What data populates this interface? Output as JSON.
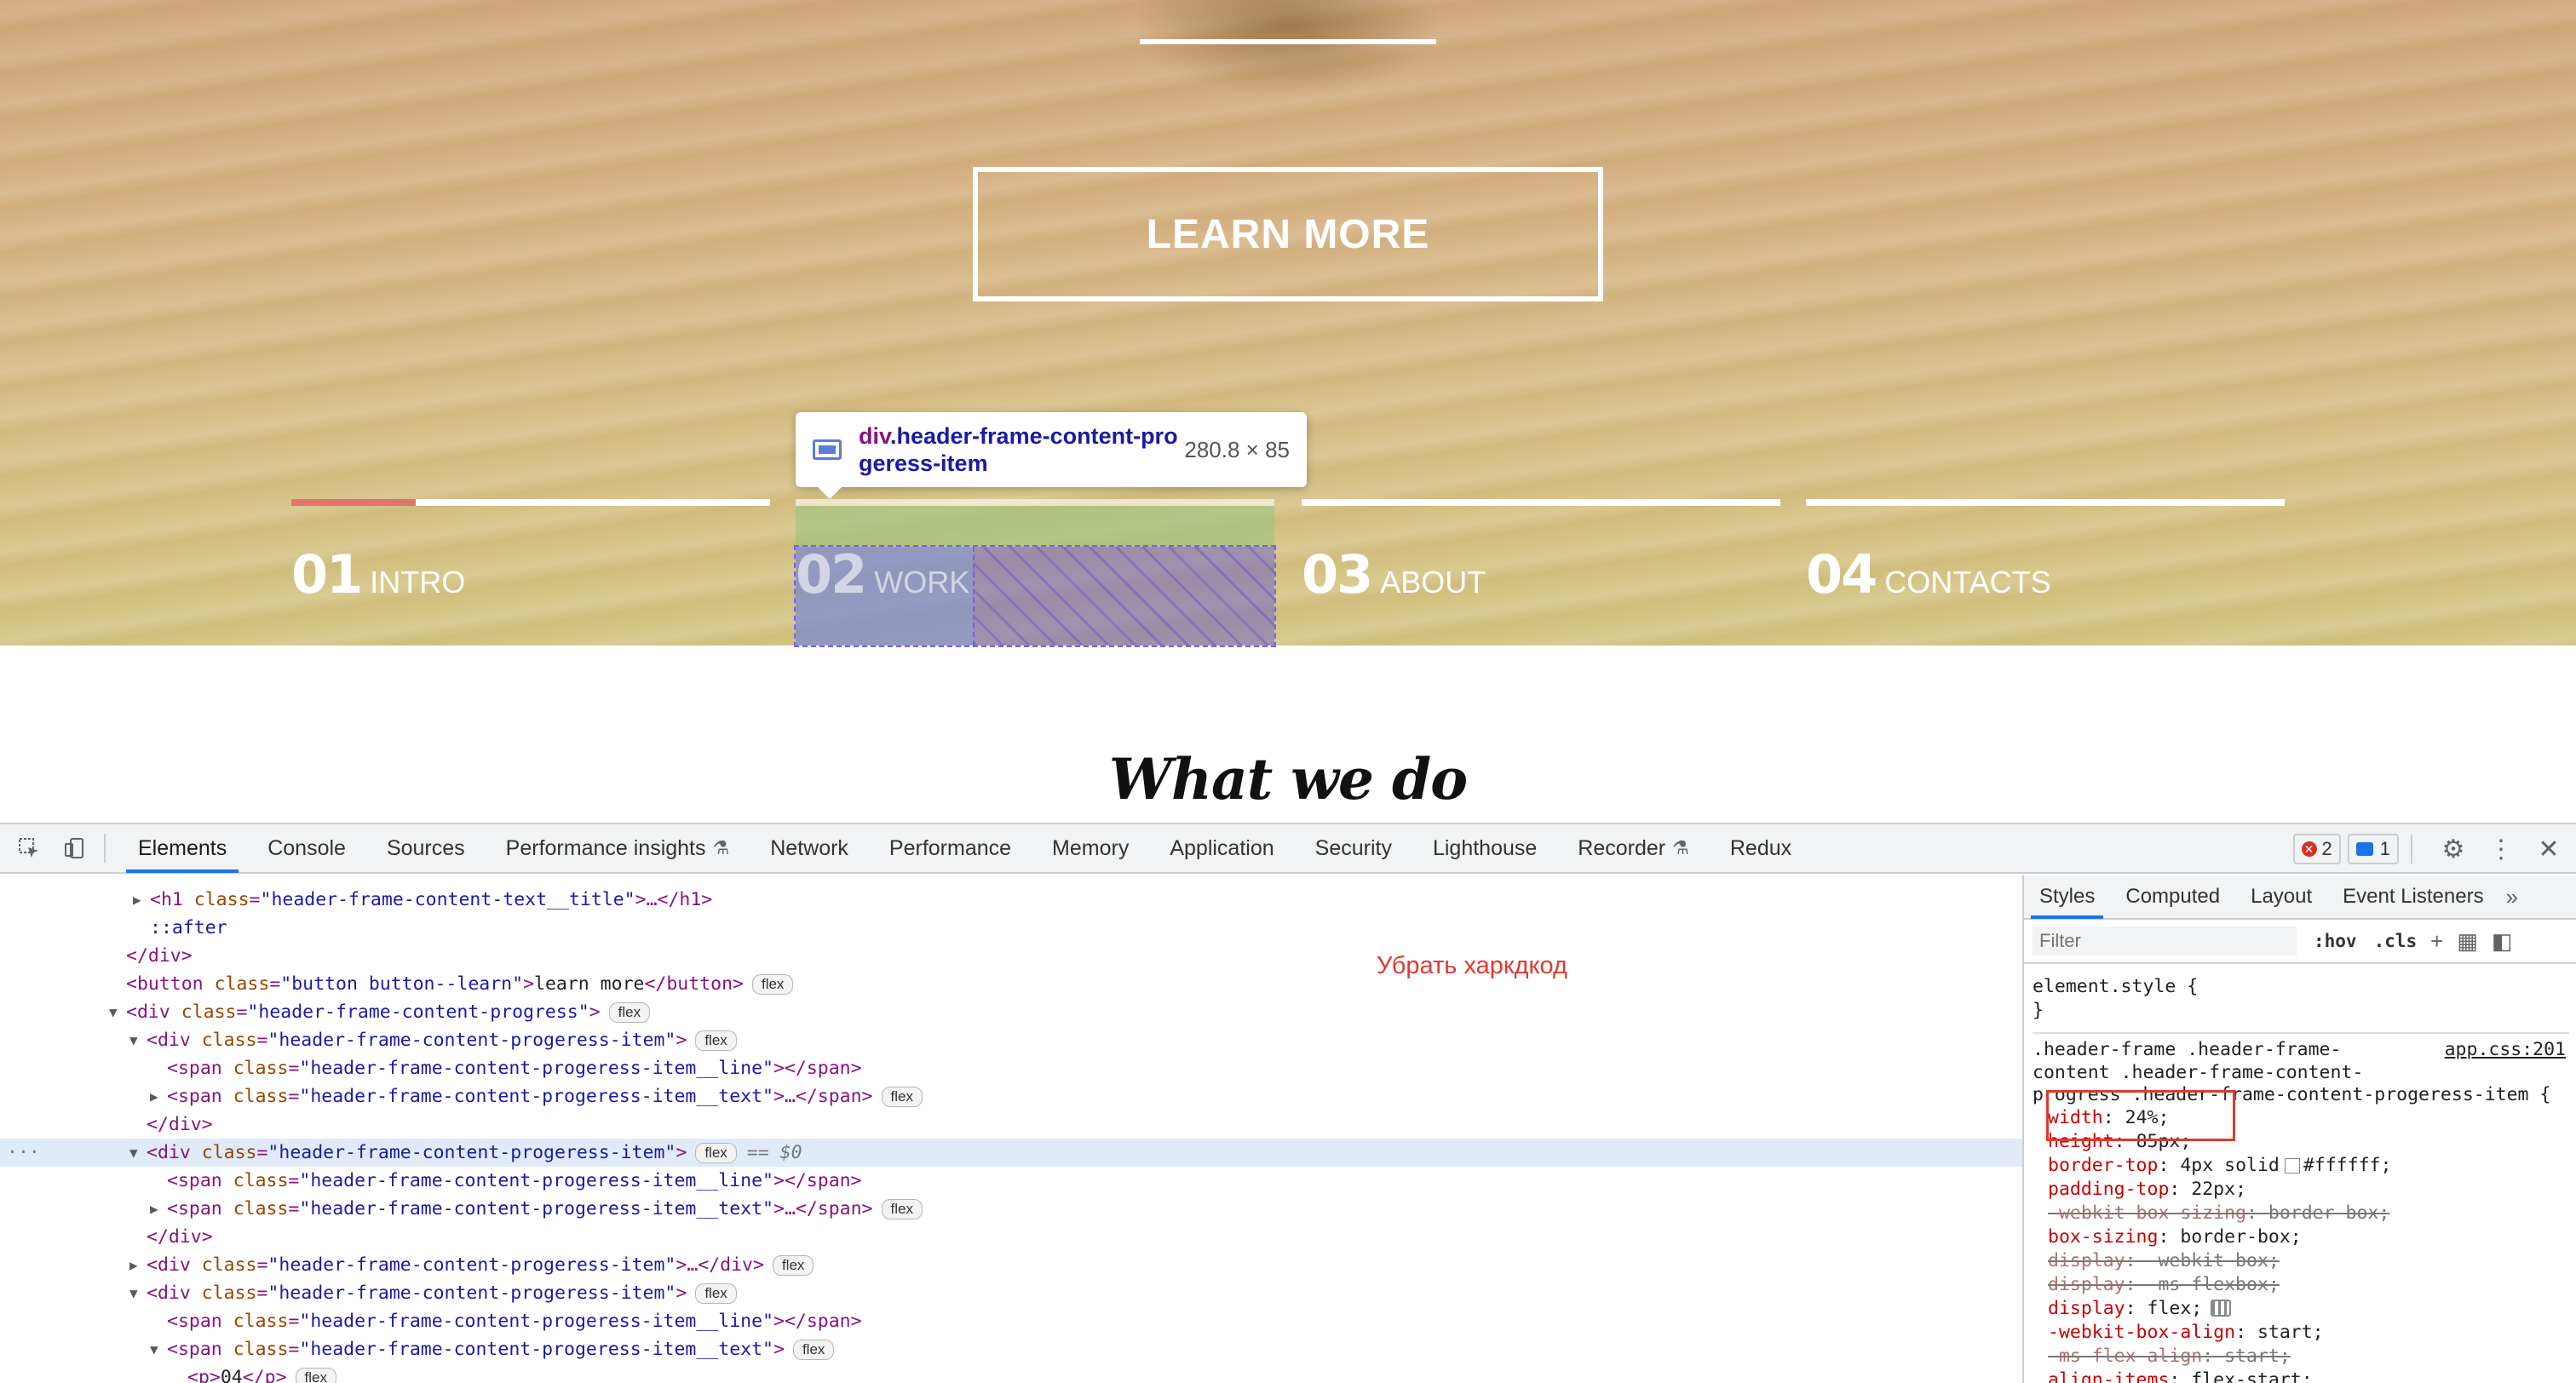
{
  "hero": {
    "learn_button": "LEARN MORE",
    "progress_items": [
      {
        "num": "01",
        "label": "INTRO",
        "fill": 0.26
      },
      {
        "num": "02",
        "label": "WORK",
        "fill": 0
      },
      {
        "num": "03",
        "label": "ABOUT",
        "fill": 0
      },
      {
        "num": "04",
        "label": "CONTACTS",
        "fill": 0
      }
    ],
    "section_title": "What we do"
  },
  "tooltip": {
    "tag": "div",
    "class_name": ".header-frame-content-progeress-item",
    "size": "280.8 × 85"
  },
  "devtools": {
    "tabs": [
      {
        "label": "Elements",
        "active": true,
        "experimental": false
      },
      {
        "label": "Console",
        "active": false,
        "experimental": false
      },
      {
        "label": "Sources",
        "active": false,
        "experimental": false
      },
      {
        "label": "Performance insights",
        "active": false,
        "experimental": true
      },
      {
        "label": "Network",
        "active": false,
        "experimental": false
      },
      {
        "label": "Performance",
        "active": false,
        "experimental": false
      },
      {
        "label": "Memory",
        "active": false,
        "experimental": false
      },
      {
        "label": "Application",
        "active": false,
        "experimental": false
      },
      {
        "label": "Security",
        "active": false,
        "experimental": false
      },
      {
        "label": "Lighthouse",
        "active": false,
        "experimental": false
      },
      {
        "label": "Recorder",
        "active": false,
        "experimental": true
      },
      {
        "label": "Redux",
        "active": false,
        "experimental": false
      }
    ],
    "error_count": "2",
    "message_count": "1",
    "annotation": "Убрать харкдкод",
    "selected_marker": "== $0",
    "flex_badge": "flex",
    "elements": {
      "l1_tag": "h1",
      "l1_class": "header-frame-content-text__title",
      "l1_close": "…</h1>",
      "l2": "::after",
      "l3": "</div>",
      "l4_tag": "button",
      "l4_class": "button button--learn",
      "l4_text": "learn more",
      "l4_close": "</button>",
      "l5_class": "header-frame-content-progress",
      "item_class": "header-frame-content-progeress-item",
      "line_class": "header-frame-content-progeress-item__line",
      "text_class": "header-frame-content-progeress-item__text",
      "span_close": "</span>",
      "span_collapsed": "…</span>",
      "div_collapsed": "…</div>",
      "div_close": "</div>",
      "p_text": "04 ",
      "p_close": "</p>"
    },
    "styles": {
      "tabs": [
        "Styles",
        "Computed",
        "Layout",
        "Event Listeners"
      ],
      "filter_placeholder": "Filter",
      "hov": ":hov",
      "cls": ".cls",
      "element_style": "element.style {",
      "element_style_close": "}",
      "rule_selector_1": ".header-frame .header-frame-",
      "rule_selector_2": "content .header-frame-content-",
      "rule_selector_3": "progress .header-frame-content-progeress-item {",
      "source": "app.css:201",
      "declarations": [
        {
          "prop": "width",
          "value": "24%;",
          "struck": false
        },
        {
          "prop": "height",
          "value": "85px;",
          "struck": false
        },
        {
          "prop": "border-top",
          "value": "4px solid",
          "color": "#ffffff;",
          "struck": false
        },
        {
          "prop": "padding-top",
          "value": "22px;",
          "struck": false
        },
        {
          "prop": "-webkit-box-sizing",
          "value": "border-box;",
          "struck": true
        },
        {
          "prop": "box-sizing",
          "value": "border-box;",
          "struck": false
        },
        {
          "prop": "display",
          "value": "-webkit-box;",
          "struck": true
        },
        {
          "prop": "display",
          "value": "-ms-flexbox;",
          "struck": true
        },
        {
          "prop": "display",
          "value": "flex;",
          "struck": false
        },
        {
          "prop": "-webkit-box-align",
          "value": "start;",
          "struck": false
        },
        {
          "prop": "-ms-flex-align",
          "value": "start;",
          "struck": true
        },
        {
          "prop": "align-items",
          "value": "flex-start;",
          "struck": false
        }
      ]
    }
  }
}
